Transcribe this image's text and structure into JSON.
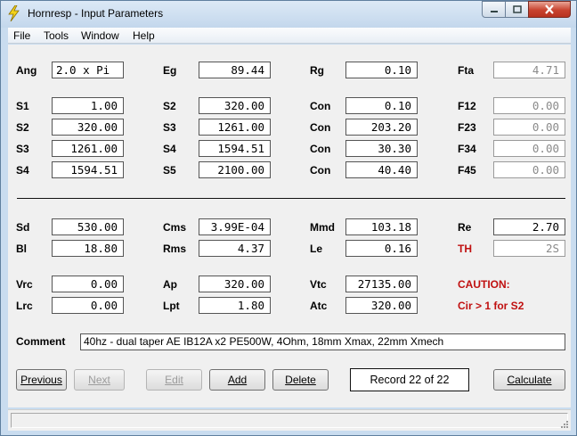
{
  "window": {
    "title": "Hornresp - Input Parameters"
  },
  "menu": [
    "File",
    "Tools",
    "Window",
    "Help"
  ],
  "top": {
    "ang": {
      "label": "Ang",
      "value": "2.0 x Pi"
    },
    "eg": {
      "label": "Eg",
      "value": "89.44"
    },
    "rg": {
      "label": "Rg",
      "value": "0.10"
    },
    "fta": {
      "label": "Fta",
      "value": "4.71"
    }
  },
  "segments": [
    {
      "s_a_label": "S1",
      "s_a": "1.00",
      "s_b_label": "S2",
      "s_b": "320.00",
      "con_label": "Con",
      "con": "0.10",
      "f_label": "F12",
      "f": "0.00"
    },
    {
      "s_a_label": "S2",
      "s_a": "320.00",
      "s_b_label": "S3",
      "s_b": "1261.00",
      "con_label": "Con",
      "con": "203.20",
      "f_label": "F23",
      "f": "0.00"
    },
    {
      "s_a_label": "S3",
      "s_a": "1261.00",
      "s_b_label": "S4",
      "s_b": "1594.51",
      "con_label": "Con",
      "con": "30.30",
      "f_label": "F34",
      "f": "0.00"
    },
    {
      "s_a_label": "S4",
      "s_a": "1594.51",
      "s_b_label": "S5",
      "s_b": "2100.00",
      "con_label": "Con",
      "con": "40.40",
      "f_label": "F45",
      "f": "0.00"
    }
  ],
  "driver": {
    "sd": {
      "label": "Sd",
      "value": "530.00"
    },
    "cms": {
      "label": "Cms",
      "value": "3.99E-04"
    },
    "mmd": {
      "label": "Mmd",
      "value": "103.18"
    },
    "re": {
      "label": "Re",
      "value": "2.70"
    },
    "bl": {
      "label": "Bl",
      "value": "18.80"
    },
    "rms": {
      "label": "Rms",
      "value": "4.37"
    },
    "le": {
      "label": "Le",
      "value": "0.16"
    },
    "th": {
      "label": "TH",
      "value": "2S"
    }
  },
  "chamber": {
    "vrc": {
      "label": "Vrc",
      "value": "0.00"
    },
    "ap": {
      "label": "Ap",
      "value": "320.00"
    },
    "vtc": {
      "label": "Vtc",
      "value": "27135.00"
    },
    "lrc": {
      "label": "Lrc",
      "value": "0.00"
    },
    "lpt": {
      "label": "Lpt",
      "value": "1.80"
    },
    "atc": {
      "label": "Atc",
      "value": "320.00"
    }
  },
  "warning": {
    "title": "CAUTION:",
    "message": "Cir > 1 for S2"
  },
  "comment": {
    "label": "Comment",
    "value": "40hz - dual taper AE IB12A x2 PE500W, 4Ohm, 18mm Xmax, 22mm Xmech"
  },
  "buttons": {
    "previous": "Previous",
    "next": "Next",
    "edit": "Edit",
    "add": "Add",
    "delete": "Delete",
    "calculate": "Calculate"
  },
  "record": "Record 22 of 22",
  "colors": {
    "warning": "#c01010",
    "titlebar": "#c9dcef",
    "client": "#f0f0f0"
  }
}
